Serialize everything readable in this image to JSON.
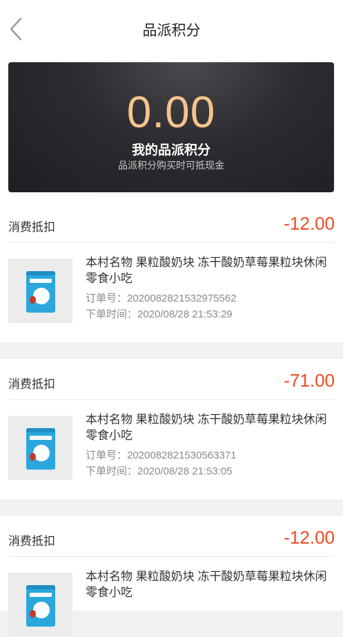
{
  "header": {
    "title": "品派积分",
    "back_icon": "chevron-left-icon"
  },
  "points": {
    "value": "0.00",
    "label": "我的品派积分",
    "subtitle": "品派积分购买时可抵现金",
    "value_color": "#f5c48c"
  },
  "colors": {
    "amount": "#ef4a22",
    "secondary_text": "#8a8a8a"
  },
  "records": [
    {
      "type": "消费抵扣",
      "amount": "-12.00",
      "product_title": "本村名物 果粒酸奶块 冻干酸奶草莓果粒块休闲零食小吃",
      "order_no": "订单号：2020082821532975562",
      "order_time": "下单时间：2020/08/28  21:53:29"
    },
    {
      "type": "消费抵扣",
      "amount": "-71.00",
      "product_title": "本村名物 果粒酸奶块 冻干酸奶草莓果粒块休闲零食小吃",
      "order_no": "订单号：2020082821530563371",
      "order_time": "下单时间：2020/08/28  21:53:05"
    },
    {
      "type": "消费抵扣",
      "amount": "-12.00",
      "product_title": "本村名物 果粒酸奶块 冻干酸奶草莓果粒块休闲零食小吃",
      "order_no": "",
      "order_time": ""
    }
  ]
}
